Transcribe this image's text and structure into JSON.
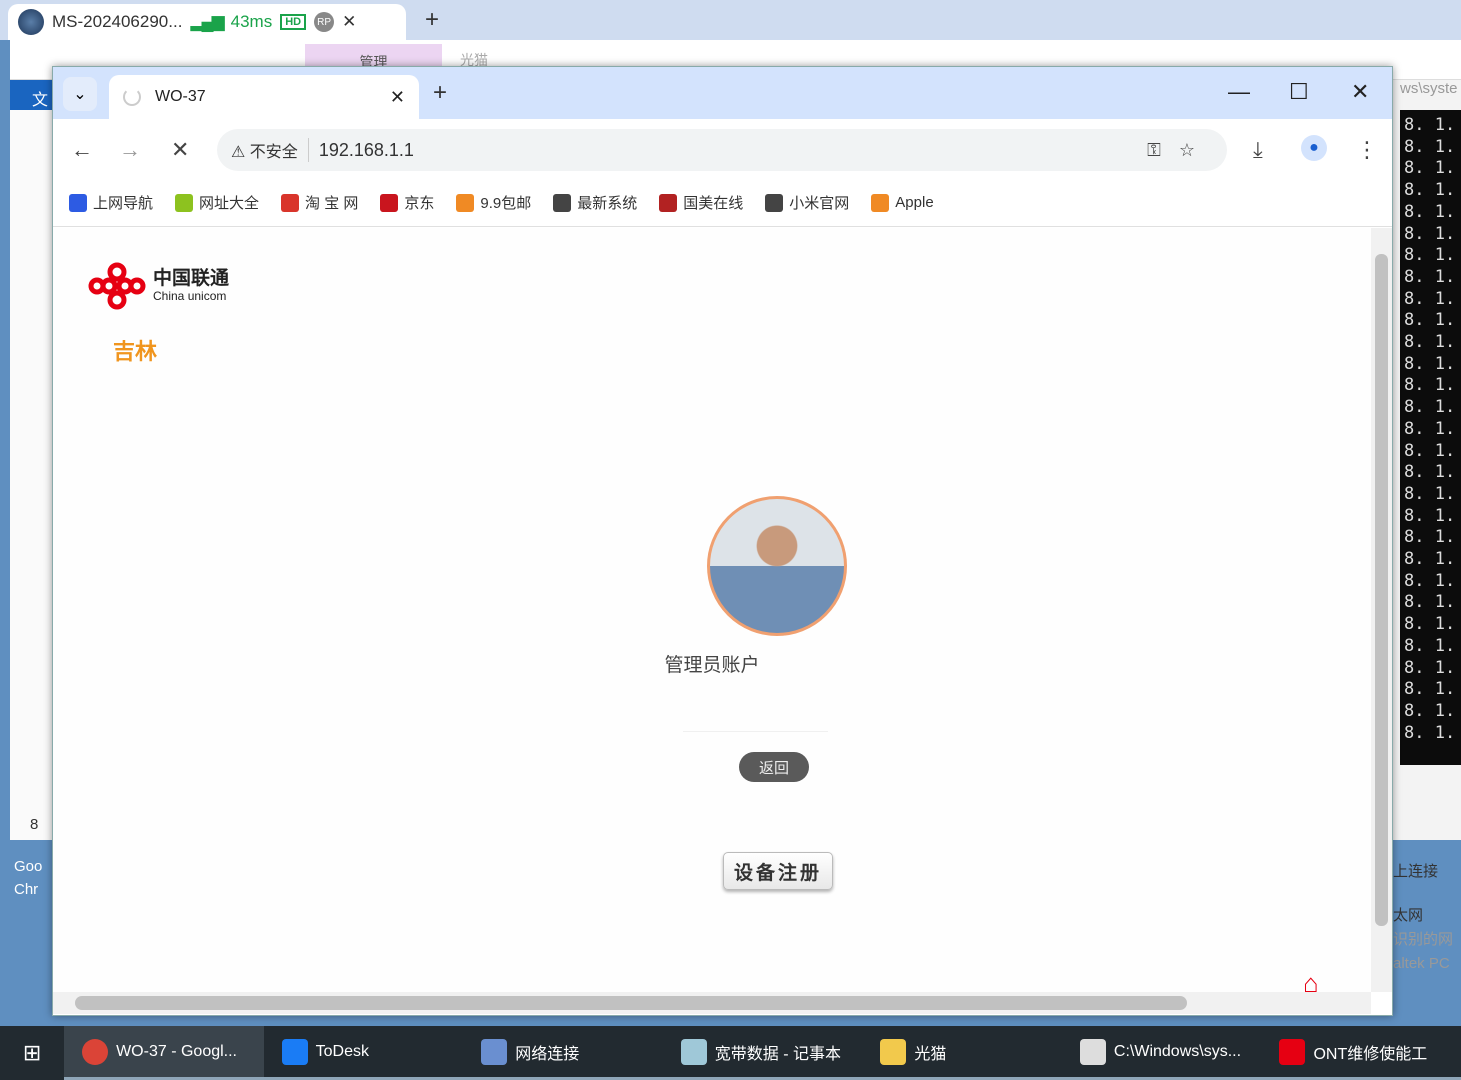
{
  "remote": {
    "title": "MS-202406290...",
    "latency": "43ms",
    "hd": "HD",
    "rp": "RP",
    "close": "✕",
    "new_tab": "+"
  },
  "background_window": {
    "ribbon_tab_manage": "管理",
    "ribbon_tab_gm": "光猫",
    "file_tab": "文",
    "cmd_title": "ws\\syste",
    "cmd_line": "8. 1. 1",
    "cmd_line_count": 29,
    "net_labels": [
      "上连接",
      "太网",
      "识别的网",
      "altek PC"
    ],
    "desktop_labels": [
      "Goo",
      "Chr"
    ],
    "side_num": "8"
  },
  "browser": {
    "tab": {
      "title": "WO-37",
      "close": "✕"
    },
    "new_tab": "+",
    "window": {
      "minimize": "—",
      "maximize": "☐",
      "close": "✕"
    },
    "nav": {
      "back": "←",
      "forward": "→",
      "stop": "✕"
    },
    "omnibox": {
      "security": "不安全",
      "url": "192.168.1.1"
    },
    "bookmarks": [
      {
        "label": "上网导航",
        "icon": "baidu-paw",
        "color": "#2d5be3"
      },
      {
        "label": "网址大全",
        "icon": "plus-circle",
        "color": "#8dc21f"
      },
      {
        "label": "淘 宝 网",
        "icon": "taobao",
        "color": "#d9352b"
      },
      {
        "label": "京东",
        "icon": "jd",
        "color": "#c9151e"
      },
      {
        "label": "9.9包邮",
        "icon": "taobao",
        "color": "#f08a24"
      },
      {
        "label": "最新系统",
        "icon": "globe",
        "color": "#444444"
      },
      {
        "label": "国美在线",
        "icon": "gome",
        "color": "#b22222"
      },
      {
        "label": "小米官网",
        "icon": "globe",
        "color": "#444444"
      },
      {
        "label": "Apple",
        "icon": "taobao",
        "color": "#f08a24"
      }
    ]
  },
  "page": {
    "logo_cn": "中国联通",
    "logo_en": "China unicom",
    "region": "吉林",
    "account_label": "管理员账户",
    "password_placeholder": "",
    "back_button": "返回",
    "register_button": "设备注册",
    "brand_color": "#e60012",
    "region_color": "#f0951e"
  },
  "taskbar": {
    "items": [
      {
        "label": "WO-37 - Googl...",
        "icon": "chrome",
        "active": true
      },
      {
        "label": "ToDesk",
        "icon": "todesk"
      },
      {
        "label": "网络连接",
        "icon": "network"
      },
      {
        "label": "宽带数据 - 记事本",
        "icon": "notepad"
      },
      {
        "label": "光猫",
        "icon": "folder"
      },
      {
        "label": "C:\\Windows\\sys...",
        "icon": "cmd"
      },
      {
        "label": "ONT维修使能工",
        "icon": "huawei"
      }
    ]
  }
}
